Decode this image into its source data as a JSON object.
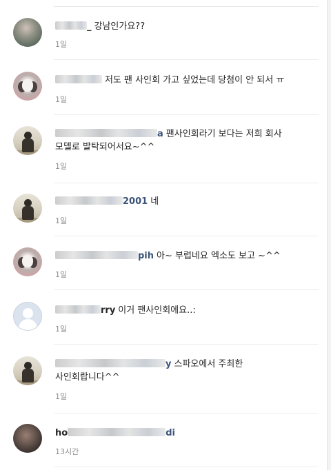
{
  "comments": [
    {
      "username_suffix": "_",
      "text": "강남인가요??",
      "time": "1일"
    },
    {
      "username_suffix": "",
      "text": "저도 팬 사인회 가고 싶었는데 당첨이 안 되서 ㅠ",
      "time": "1일"
    },
    {
      "username_suffix": "a",
      "text": "팬사인회라기 보다는 저희 회사",
      "text2": "모델로 발탁되어서요~^^",
      "time": "1일"
    },
    {
      "username_suffix": "2001",
      "text": "네",
      "time": "1일"
    },
    {
      "username_suffix": "pih",
      "text": "아~ 부럽네요 엑소도 보고 ~^^",
      "time": "1일"
    },
    {
      "username_suffix": "rry",
      "text": "이거 팬사인회에요..:",
      "time": "1일"
    },
    {
      "username_suffix": "y",
      "text": "스파오에서 주최한",
      "text2": "사인회랍니다^^",
      "time": "1일"
    },
    {
      "username_prefix": "ho",
      "username_suffix": "di",
      "text": "",
      "time": "13시간"
    }
  ]
}
